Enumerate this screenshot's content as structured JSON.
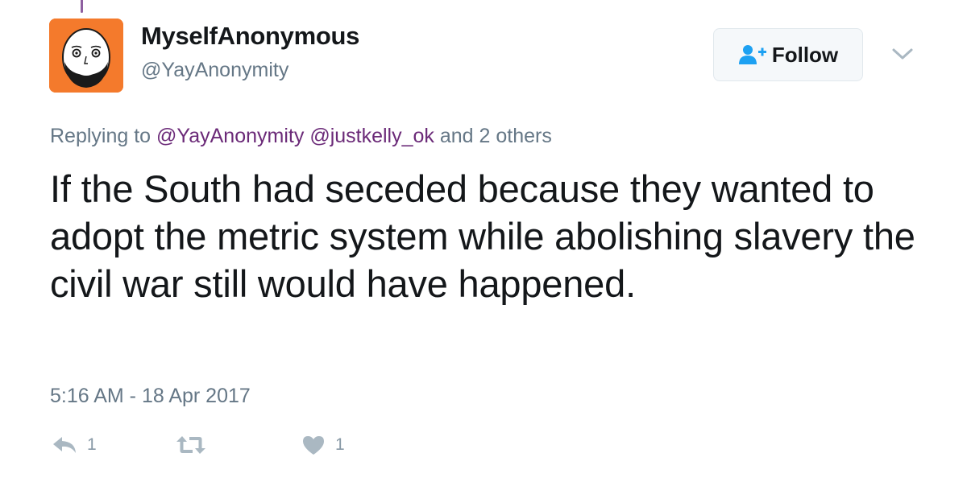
{
  "user": {
    "display_name": "MyselfAnonymous",
    "handle": "@YayAnonymity",
    "avatar_icon": "bald-bearded-face-avatar",
    "avatar_color": "#f47a2c"
  },
  "follow_button": {
    "label": "Follow",
    "icon": "follow-user-icon",
    "accent": "#1da1f2"
  },
  "reply_context": {
    "prefix": "Replying to",
    "mentions": [
      "@YayAnonymity",
      "@justkelly_ok"
    ],
    "suffix": "and 2 others",
    "mention_color": "#6b2a78"
  },
  "tweet": {
    "text": "If the South had seceded because they wanted to adopt the metric system while abolishing slavery the civil war still would have happened.",
    "timestamp": "5:16 AM - 18 Apr 2017"
  },
  "actions": {
    "reply": {
      "icon": "reply-icon",
      "count": "1"
    },
    "retweet": {
      "icon": "retweet-icon",
      "count": ""
    },
    "like": {
      "icon": "heart-icon",
      "count": "1"
    }
  },
  "colors": {
    "text_primary": "#14171a",
    "text_secondary": "#657786",
    "icon_gray": "#aab8c2",
    "thread_line": "#8e5fa0"
  }
}
